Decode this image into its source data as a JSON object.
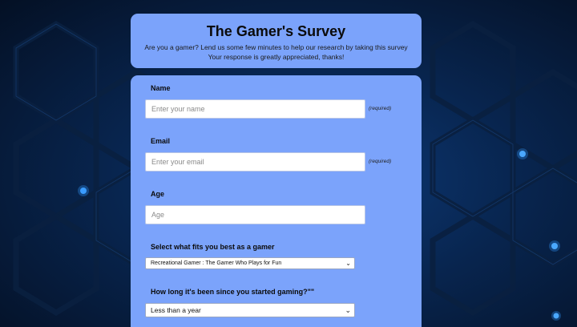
{
  "header": {
    "title": "The Gamer's Survey",
    "description_line1": "Are you a gamer? Lend us some few minutes to help our research by taking this survey",
    "description_line2": "Your response is greatly appreciated, thanks!"
  },
  "form": {
    "name": {
      "label": "Name",
      "placeholder": "Enter your name",
      "value": "",
      "required_note": "(required)"
    },
    "email": {
      "label": "Email",
      "placeholder": "Enter your email",
      "value": "",
      "required_note": "(required)"
    },
    "age": {
      "label": "Age",
      "placeholder": "Age",
      "value": ""
    },
    "gamer_type": {
      "label": "Select what fits you best as a gamer",
      "selected": "Recreational Gamer : The Gamer Who Plays for Fun"
    },
    "gaming_duration": {
      "label": "How long it's been since you started gaming?\"\"",
      "selected": "Less than a year"
    }
  },
  "icons": {
    "dropdown": "chevron-down-icon"
  },
  "colors": {
    "card_background": "#7ba3fb",
    "page_background": "#06152e",
    "accent_node": "#2e8ff0"
  }
}
